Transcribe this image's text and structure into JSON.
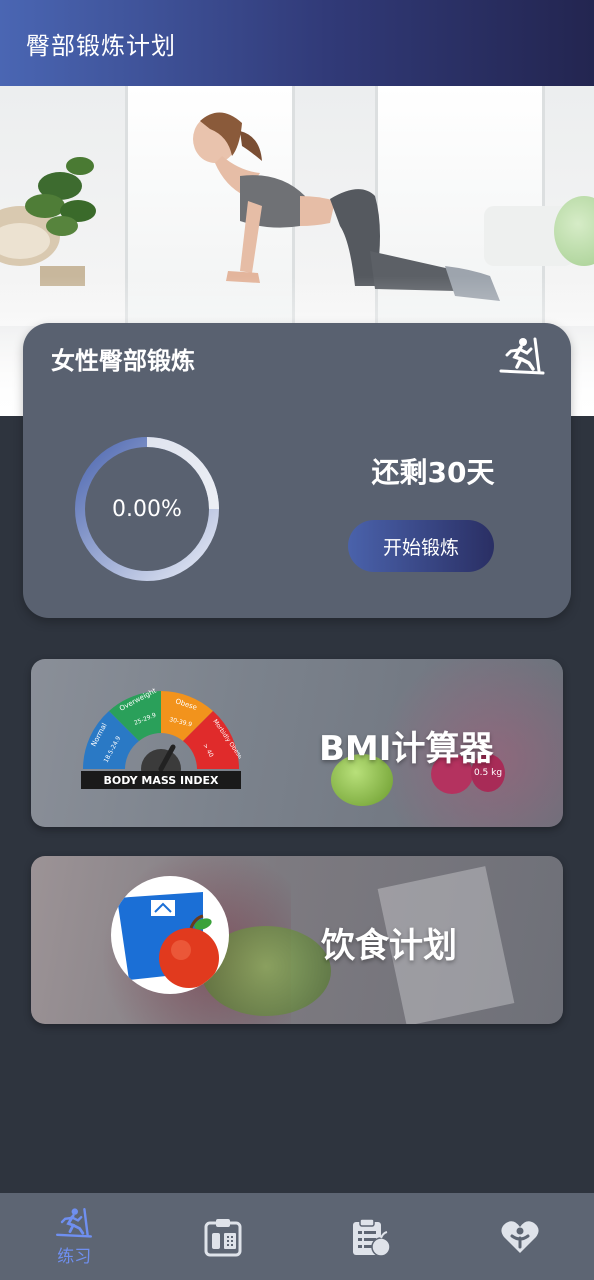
{
  "app_bar": {
    "title": "臀部锻炼计划"
  },
  "workout_card": {
    "title": "女性臀部锻炼",
    "progress_text": "0.00%",
    "progress": 0.0,
    "days_left": "还剩30天",
    "start_label": "开始锻炼",
    "icon": "treadmill-icon"
  },
  "bmi_card": {
    "label": "BMI计算器",
    "gauge_title": "BODY MASS INDEX",
    "gauge_ranges": [
      "Normal",
      "Overweight",
      "Obese",
      "Morbidly Obese"
    ],
    "gauge_values": [
      "18.5-24.9",
      "25-29.9",
      "30-39.9",
      "> 40"
    ],
    "dumbbell_weight": "0.5 kg"
  },
  "diet_card": {
    "label": "饮食计划",
    "icon": "scale-apple-icon"
  },
  "bottom_nav": {
    "items": [
      {
        "label": "练习",
        "icon": "treadmill-icon",
        "active": true
      },
      {
        "label": "",
        "icon": "scale-clipboard-icon",
        "active": false
      },
      {
        "label": "",
        "icon": "diet-clipboard-icon",
        "active": false
      },
      {
        "label": "",
        "icon": "health-heart-icon",
        "active": false
      }
    ]
  },
  "colors": {
    "app_bar_start": "#4a66b3",
    "app_bar_end": "#232550",
    "card_bg": "#596170",
    "page_bg": "#2e343e",
    "nav_bg": "#5d6573",
    "nav_active": "#6f8ff0",
    "ring_start": "#4c66b0",
    "ring_end": "#e8ecf6"
  }
}
